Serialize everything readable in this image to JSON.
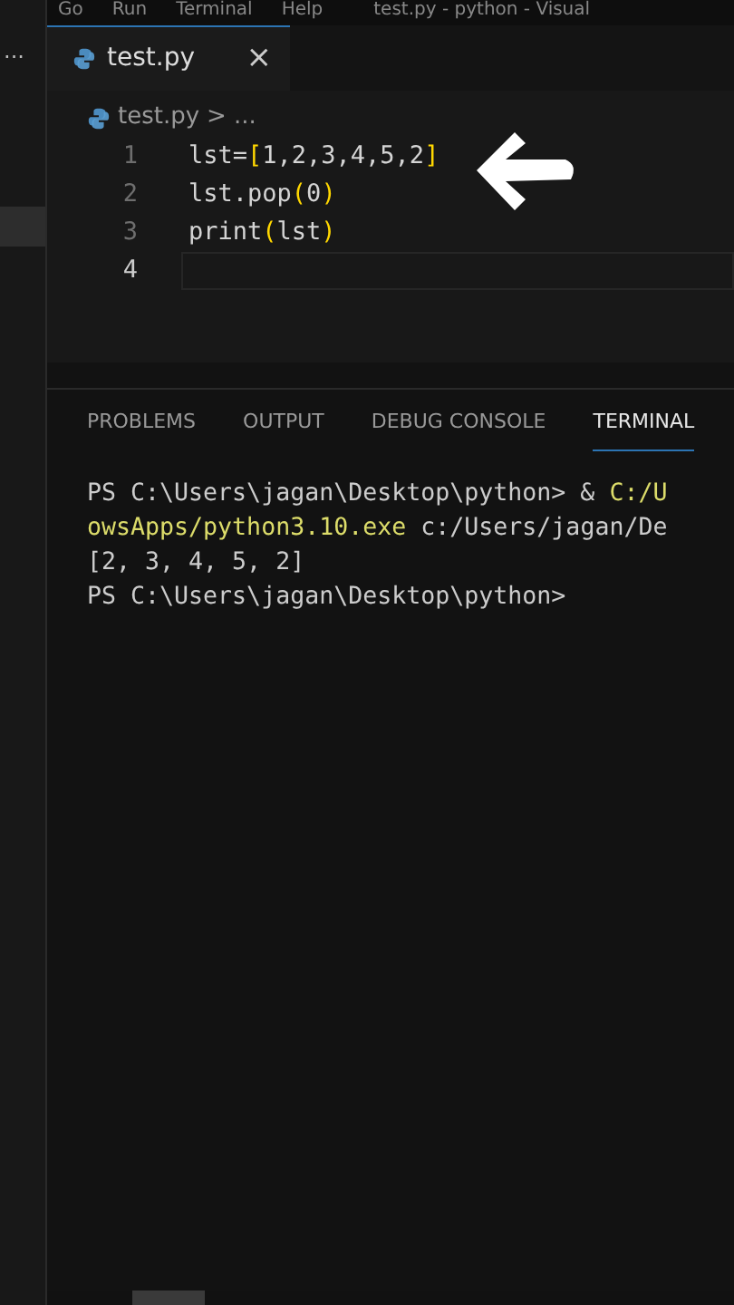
{
  "menu": [
    "Go",
    "Run",
    "Terminal",
    "Help"
  ],
  "window": {
    "title": "test.py - python - Visual"
  },
  "sidebar": {
    "more": "...",
    "items": [
      {
        "selected": true
      }
    ]
  },
  "tabs": [
    {
      "label": "test.py",
      "close": "×",
      "selected": true
    }
  ],
  "breadcrumb": {
    "file": "test.py",
    "separator": ">",
    "rest": "..."
  },
  "code": [
    {
      "number": "1",
      "current": false,
      "tokens": [
        {
          "kind": "text",
          "text": "lst="
        },
        {
          "kind": "bracket",
          "text": "["
        },
        {
          "kind": "text",
          "text": "1,2,3,4,5,2"
        },
        {
          "kind": "bracket",
          "text": "]"
        }
      ]
    },
    {
      "number": "2",
      "current": false,
      "tokens": [
        {
          "kind": "text",
          "text": "lst.pop"
        },
        {
          "kind": "bracket",
          "text": "("
        },
        {
          "kind": "text",
          "text": "0"
        },
        {
          "kind": "bracket",
          "text": ")"
        }
      ]
    },
    {
      "number": "3",
      "current": false,
      "tokens": [
        {
          "kind": "text",
          "text": "print"
        },
        {
          "kind": "bracket",
          "text": "("
        },
        {
          "kind": "text",
          "text": "lst"
        },
        {
          "kind": "bracket",
          "text": ")"
        }
      ]
    },
    {
      "number": "4",
      "current": true
    }
  ],
  "panel_tabs": [
    {
      "label": "PROBLEMS",
      "selected": false
    },
    {
      "label": "OUTPUT",
      "selected": false
    },
    {
      "label": "DEBUG CONSOLE",
      "selected": false
    },
    {
      "label": "TERMINAL",
      "selected": true
    }
  ],
  "terminal": [
    [
      {
        "kind": "plain",
        "text": "PS C:\\Users\\jagan\\Desktop\\python> & "
      },
      {
        "kind": "path",
        "text": "C:/U"
      }
    ],
    [
      {
        "kind": "path",
        "text": "owsApps/python3.10.exe"
      },
      {
        "kind": "plain",
        "text": " c:/Users/jagan/De"
      }
    ],
    [
      {
        "kind": "plain",
        "text": "[2, 3, 4, 5, 2]"
      }
    ],
    [
      {
        "kind": "plain",
        "text": "PS C:\\Users\\jagan\\Desktop\\python>"
      }
    ]
  ]
}
